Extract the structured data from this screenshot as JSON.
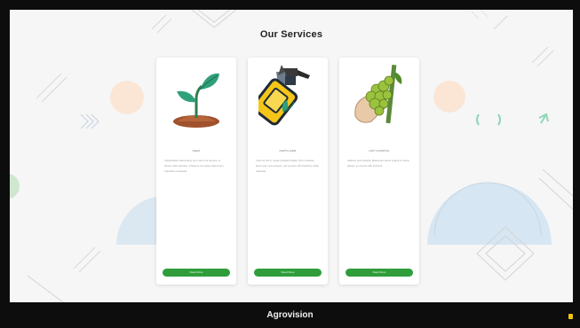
{
  "section": {
    "title": "Our Services"
  },
  "cards": [
    {
      "icon": "seedling-icon",
      "title": "SEED",
      "text": "Suspendisse ullamcorper arcu sed urna tempus, ut dictum dolor faucibus. Praesent vel neque vitae lorem vulputate consequat.",
      "button": "Read More"
    },
    {
      "icon": "spray-bottle-icon",
      "title": "FERTILIZER",
      "text": "Cras vel nisi in neque gravida fringilla. Proin molestie lacus quis eros posuere, nec tempus nibh faucibus. Nulla vulputate.",
      "button": "Read More"
    },
    {
      "icon": "hops-icon",
      "title": "HOP FARMING",
      "text": "Aliquam erat volutpat. Maecenas varius magna et metus aliquet, eu cursus nibh tincidunt.",
      "button": "Read More"
    }
  ],
  "footer": {
    "brand": "Agrovision"
  },
  "colors": {
    "accent": "#2f9d3a",
    "footer": "#0d0d0d",
    "background": "#f6f6f6",
    "indicator": "#f1c40f"
  }
}
